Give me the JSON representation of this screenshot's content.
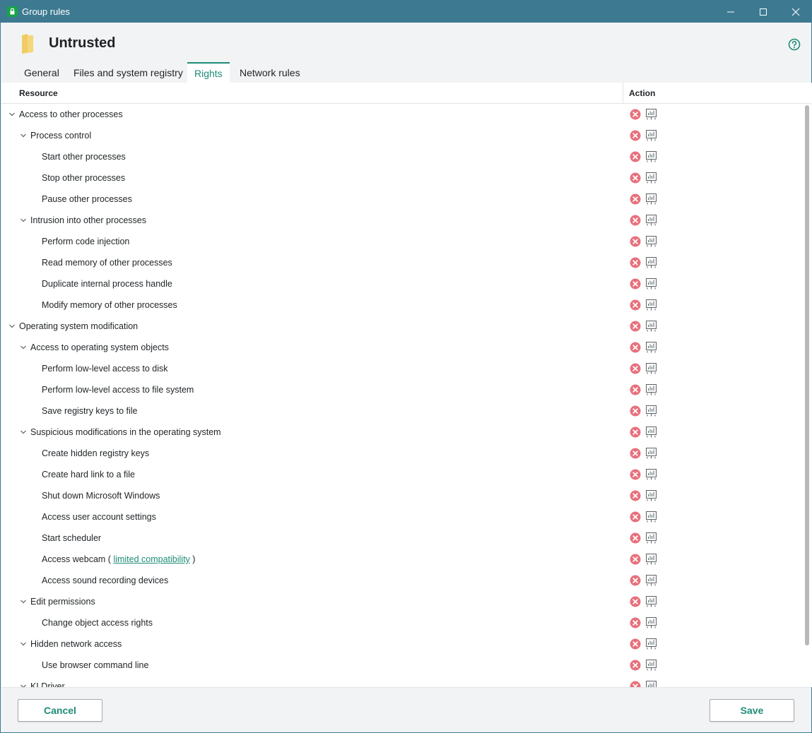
{
  "window": {
    "title": "Group rules",
    "page_title": "Untrusted"
  },
  "tabs": [
    {
      "label": "General",
      "active": false
    },
    {
      "label": "Files and system registry",
      "active": false
    },
    {
      "label": "Rights",
      "active": true
    },
    {
      "label": "Network rules",
      "active": false
    }
  ],
  "table": {
    "col_resource": "Resource",
    "col_action": "Action",
    "rows": [
      {
        "label": "Access to other processes",
        "level": 0,
        "expandable": true
      },
      {
        "label": "Process control",
        "level": 1,
        "expandable": true
      },
      {
        "label": "Start other processes",
        "level": 2
      },
      {
        "label": "Stop other processes",
        "level": 2
      },
      {
        "label": "Pause other processes",
        "level": 2
      },
      {
        "label": "Intrusion into other processes",
        "level": 1,
        "expandable": true
      },
      {
        "label": "Perform code injection",
        "level": 2
      },
      {
        "label": "Read memory of other processes",
        "level": 2
      },
      {
        "label": "Duplicate internal process handle",
        "level": 2
      },
      {
        "label": "Modify memory of other processes",
        "level": 2
      },
      {
        "label": "Operating system modification",
        "level": 0,
        "expandable": true
      },
      {
        "label": "Access to operating system objects",
        "level": 1,
        "expandable": true
      },
      {
        "label": "Perform low-level access to disk",
        "level": 2
      },
      {
        "label": "Perform low-level access to file system",
        "level": 2
      },
      {
        "label": "Save registry keys to file",
        "level": 2
      },
      {
        "label": "Suspicious modifications in the operating system",
        "level": 1,
        "expandable": true
      },
      {
        "label": "Create hidden registry keys",
        "level": 2
      },
      {
        "label": "Create hard link to a file",
        "level": 2
      },
      {
        "label": "Shut down Microsoft Windows",
        "level": 2
      },
      {
        "label": "Access user account settings",
        "level": 2
      },
      {
        "label": "Start scheduler",
        "level": 2
      },
      {
        "label": "Access webcam (",
        "level": 2,
        "link": "limited compatibility",
        "suffix": ")"
      },
      {
        "label": "Access sound recording devices",
        "level": 2
      },
      {
        "label": "Edit permissions",
        "level": 1,
        "expandable": true
      },
      {
        "label": "Change object access rights",
        "level": 2
      },
      {
        "label": "Hidden network access",
        "level": 1,
        "expandable": true
      },
      {
        "label": "Use browser command line",
        "level": 2
      },
      {
        "label": "KLDriver",
        "level": 1,
        "expandable": true
      }
    ]
  },
  "actions": {
    "row_action_icons": [
      "block-icon",
      "log-icon"
    ]
  },
  "footer": {
    "cancel_label": "Cancel",
    "save_label": "Save"
  },
  "colors": {
    "titlebar": "#3d7a92",
    "accent": "#1e8c78",
    "block": "#e8707c"
  }
}
